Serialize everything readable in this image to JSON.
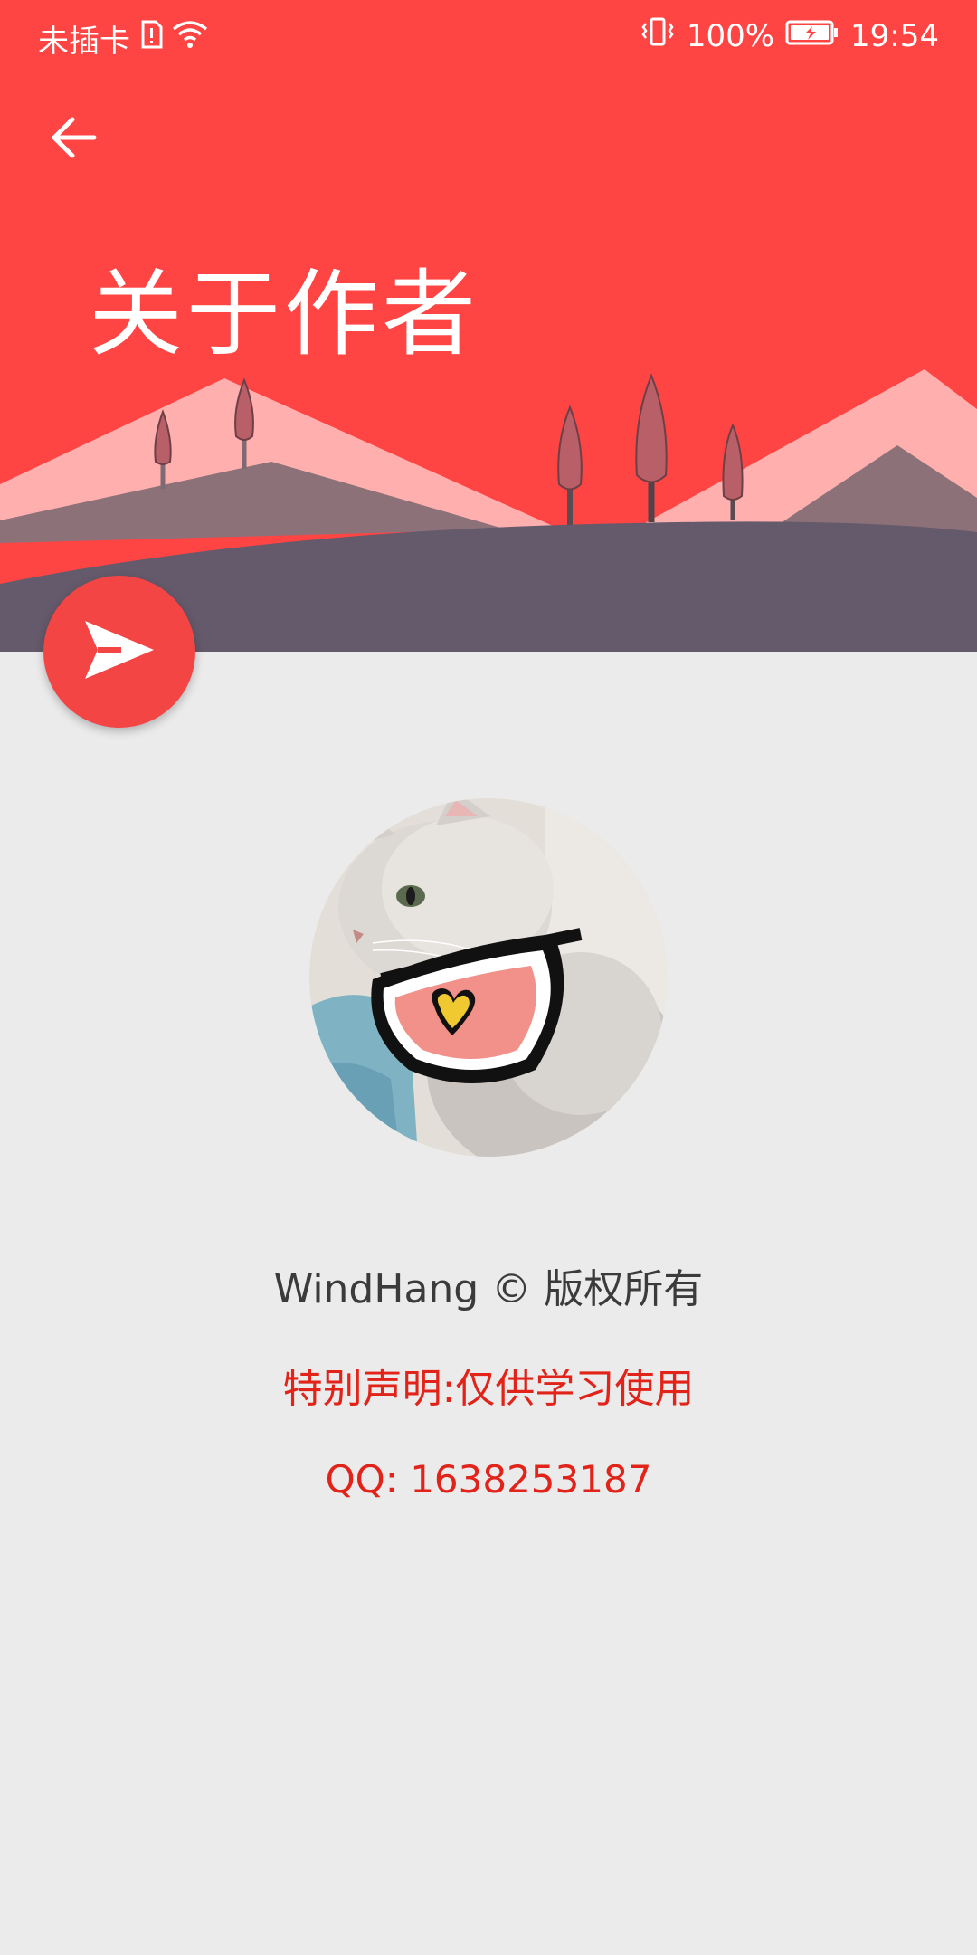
{
  "status_bar": {
    "carrier": "未插卡",
    "battery_percent": "100%",
    "time": "19:54",
    "icons": [
      "sim-alert-icon",
      "wifi-icon",
      "vibrate-icon",
      "battery-charging-icon"
    ]
  },
  "header": {
    "title": "关于作者",
    "back_icon": "arrow-left-icon",
    "fab_icon": "send-icon"
  },
  "profile": {
    "avatar_alt": "cat-avatar",
    "copyright": "WindHang © 版权所有",
    "notice": "特别声明:仅供学习使用",
    "qq": "QQ: 1638253187"
  },
  "colors": {
    "header": "#ff4444",
    "fab": "#f44545",
    "background": "#ebebeb",
    "notice_text": "#e2231a",
    "ground": "#655a6b",
    "mid_hill": "#8c7178",
    "far_hill": "#ffb0ae"
  }
}
